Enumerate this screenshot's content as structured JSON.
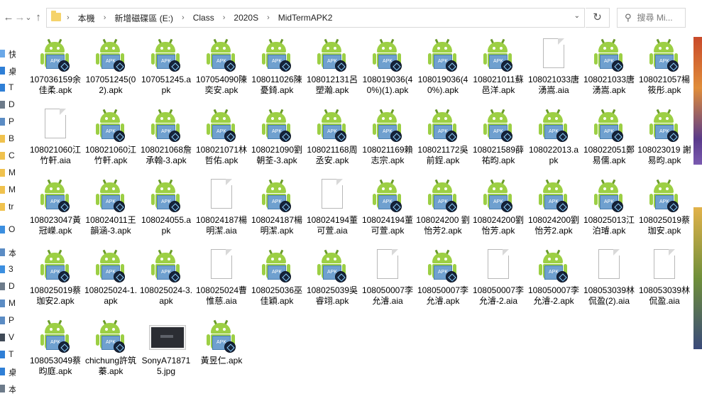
{
  "nav": {
    "back": "←",
    "forward": "→",
    "down": "⌄",
    "up": "↑"
  },
  "address": {
    "path": [
      "本機",
      "新增磁碟區 (E:)",
      "Class",
      "2020S",
      "MidTermAPK2"
    ],
    "dropdown": "⌄",
    "refresh": "↻"
  },
  "search": {
    "placeholder": "搜尋 Mi...",
    "icon": "search-icon"
  },
  "sidebar": {
    "items": [
      {
        "label": "快",
        "color": "#6aa8e8"
      },
      {
        "label": "桌",
        "color": "#2f7fd6"
      },
      {
        "label": "T",
        "color": "#2f7fd6"
      },
      {
        "label": "D",
        "color": "#6d7b8a"
      },
      {
        "label": "P",
        "color": "#5b8cc4"
      },
      {
        "label": "B",
        "color": "#f0c24e"
      },
      {
        "label": "C",
        "color": "#f0c24e"
      },
      {
        "label": "M",
        "color": "#f0c24e"
      },
      {
        "label": "M",
        "color": "#f0c24e"
      },
      {
        "label": "tr",
        "color": "#f0c24e"
      },
      {
        "label": "Or",
        "color": "#3c8fe0"
      },
      {
        "label": "本",
        "color": "#5b8cc4"
      },
      {
        "label": "3",
        "color": "#3c8fe0"
      },
      {
        "label": "D",
        "color": "#6d7b8a"
      },
      {
        "label": "M",
        "color": "#5b8cc4"
      },
      {
        "label": "P",
        "color": "#5b8cc4"
      },
      {
        "label": "V",
        "color": "#404a57"
      },
      {
        "label": "T",
        "color": "#2f7fd6"
      },
      {
        "label": "桌",
        "color": "#2f7fd6"
      },
      {
        "label": "本",
        "color": "#6d7b8a"
      }
    ]
  },
  "files": [
    {
      "name": "107036159余佳柔.apk",
      "type": "apk"
    },
    {
      "name": "107051245(02).apk",
      "type": "apk"
    },
    {
      "name": "107051245.apk",
      "type": "apk"
    },
    {
      "name": "107054090陳奕安.apk",
      "type": "apk"
    },
    {
      "name": "108011026陳憂錡.apk",
      "type": "apk"
    },
    {
      "name": "108012131呂塑瀚.apk",
      "type": "apk"
    },
    {
      "name": "108019036(40%)(1).apk",
      "type": "apk"
    },
    {
      "name": "108019036(40%).apk",
      "type": "apk"
    },
    {
      "name": "108021011蘇邑洋.apk",
      "type": "apk"
    },
    {
      "name": "108021033唐湧嵩.aia",
      "type": "aia"
    },
    {
      "name": "108021033唐湧嵩.apk",
      "type": "apk"
    },
    {
      "name": "108021057楊筱彤.apk",
      "type": "apk"
    },
    {
      "name": "108021060江竹軒.aia",
      "type": "aia"
    },
    {
      "name": "108021060江竹軒.apk",
      "type": "apk"
    },
    {
      "name": "108021068詹承翰-3.apk",
      "type": "apk"
    },
    {
      "name": "108021071林哲佑.apk",
      "type": "apk"
    },
    {
      "name": "108021090劉朝荃-3.apk",
      "type": "apk"
    },
    {
      "name": "108021168周丞安.apk",
      "type": "apk"
    },
    {
      "name": "108021169賴志宗.apk",
      "type": "apk"
    },
    {
      "name": "108021172吳前鋥.apk",
      "type": "apk"
    },
    {
      "name": "108021589薛祐昀.apk",
      "type": "apk"
    },
    {
      "name": "108022013.apk",
      "type": "apk"
    },
    {
      "name": "108022051鄭易儒.apk",
      "type": "apk"
    },
    {
      "name": "108023019 謝易昀.apk",
      "type": "apk"
    },
    {
      "name": "108023047黃冠嶸.apk",
      "type": "apk"
    },
    {
      "name": "108024011王韻涵-3.apk",
      "type": "apk"
    },
    {
      "name": "108024055.apk",
      "type": "apk"
    },
    {
      "name": "108024187楊明潔.aia",
      "type": "aia"
    },
    {
      "name": "108024187楊明潔.apk",
      "type": "apk"
    },
    {
      "name": "108024194董可萱.aia",
      "type": "aia"
    },
    {
      "name": "108024194董可萱.apk",
      "type": "apk"
    },
    {
      "name": "108024200 劉怡芳2.apk",
      "type": "apk"
    },
    {
      "name": "108024200劉怡芳.apk",
      "type": "apk"
    },
    {
      "name": "108024200劉怡芳2.apk",
      "type": "apk"
    },
    {
      "name": "108025013江泊璿.apk",
      "type": "apk"
    },
    {
      "name": "108025019蔡珈安.apk",
      "type": "apk"
    },
    {
      "name": "108025019蔡珈安2.apk",
      "type": "apk"
    },
    {
      "name": "108025024-1.apk",
      "type": "apk"
    },
    {
      "name": "108025024-3.apk",
      "type": "apk"
    },
    {
      "name": "108025024曹惟慈.aia",
      "type": "aia"
    },
    {
      "name": "108025036巫佳穎.apk",
      "type": "apk"
    },
    {
      "name": "108025039吳睿翊.apk",
      "type": "apk"
    },
    {
      "name": "108050007李允濬.aia",
      "type": "aia"
    },
    {
      "name": "108050007李允濬.apk",
      "type": "apk"
    },
    {
      "name": "108050007李允濬-2.aia",
      "type": "aia"
    },
    {
      "name": "108050007李允濬-2.apk",
      "type": "apk"
    },
    {
      "name": "108053039林侃盈(2).aia",
      "type": "aia"
    },
    {
      "name": "108053039林侃盈.aia",
      "type": "aia"
    },
    {
      "name": "108053049蔡昀庭.apk",
      "type": "apk"
    },
    {
      "name": "chichung許筑蓁.apk",
      "type": "apk"
    },
    {
      "name": "SonyA718715.jpg",
      "type": "jpg"
    },
    {
      "name": "黃昱仁.apk",
      "type": "apk"
    }
  ],
  "apk_badge_text": "APK",
  "colors": {
    "android": "#9ccf44",
    "badge": "#16233a",
    "address_border": "#d9d9d9"
  }
}
